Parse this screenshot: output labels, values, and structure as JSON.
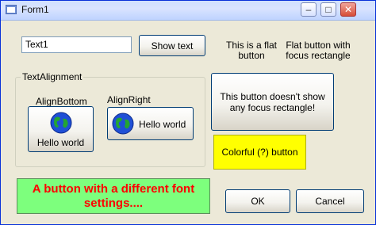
{
  "window": {
    "title": "Form1"
  },
  "titlebar": {
    "minimize": "–",
    "maximize": "□",
    "close": "✕"
  },
  "textbox": {
    "value": "Text1"
  },
  "buttons": {
    "show_text": "Show text",
    "flat_button": "This is a flat button",
    "flat_focus_button": "Flat button with focus rectangle",
    "no_focus_rect": "This button doesn't show any focus rectangle!",
    "colorful": "Colorful (?) button",
    "big_font": "A button with a different font settings....",
    "ok": "OK",
    "cancel": "Cancel"
  },
  "text_alignment": {
    "group_label": "TextAlignment",
    "align_bottom_label": "AlignBottom",
    "align_right_label": "AlignRight",
    "hello_bottom": "Hello world",
    "hello_right": "Hello world"
  },
  "colors": {
    "accent": "#0831d9",
    "green_button": "#7dff7d",
    "yellow_button": "#ffff00",
    "red_text": "#ff0000"
  }
}
